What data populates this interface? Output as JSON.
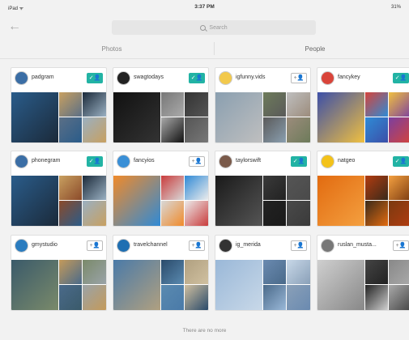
{
  "status_bar": {
    "left": "iPad ᯤ",
    "time": "3:37 PM",
    "battery": "31%"
  },
  "nav": {
    "back_icon": "←",
    "search_placeholder": "Search"
  },
  "tabs": [
    {
      "label": "Photos"
    },
    {
      "label": "People"
    }
  ],
  "follow_icon": "+👤",
  "following_icon": "✓👤",
  "cards": [
    {
      "name": "padgram",
      "following": true,
      "avatar_color": "#3b6ea5"
    },
    {
      "name": "swagtodays",
      "following": true,
      "avatar_color": "#222222"
    },
    {
      "name": "igfunny.vids",
      "following": false,
      "avatar_color": "#f2c94c"
    },
    {
      "name": "fancykey",
      "following": true,
      "avatar_color": "#d9443a"
    },
    {
      "name": "phonegram",
      "following": true,
      "avatar_color": "#3b6ea5"
    },
    {
      "name": "fancyios",
      "following": false,
      "avatar_color": "#3a8fd6"
    },
    {
      "name": "taylorswift",
      "following": true,
      "avatar_color": "#7a5a4a"
    },
    {
      "name": "natgeo",
      "following": true,
      "avatar_color": "#f3c21a"
    },
    {
      "name": "gmystudio",
      "following": false,
      "avatar_color": "#2b7cbf"
    },
    {
      "name": "travelchannel",
      "following": false,
      "avatar_color": "#1f6fb2"
    },
    {
      "name": "ig_merida",
      "following": false,
      "avatar_color": "#333333"
    },
    {
      "name": "ruslan_musta...",
      "following": false,
      "avatar_color": "#777777"
    }
  ],
  "footer": {
    "no_more": "There are no more"
  }
}
